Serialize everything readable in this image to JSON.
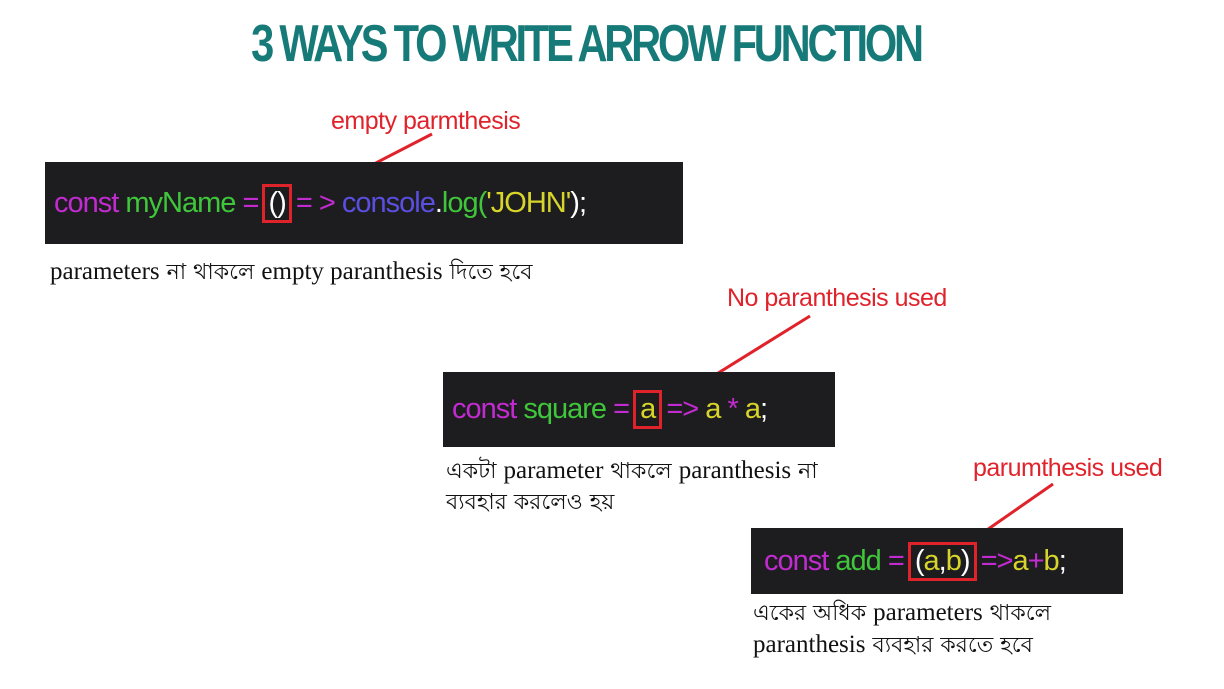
{
  "title": "3 WAYS TO WRITE ARROW FUNCTION",
  "colors": {
    "title": "#157a78",
    "annotation": "#e0232b",
    "code_bg": "#1d1d20",
    "keyword": "#c22bd0",
    "identifier": "#3fc63a",
    "operator": "#c22bd0",
    "console": "#5a4fe0",
    "string": "#d8d52a",
    "param": "#d8d52a",
    "plain": "#ffffff"
  },
  "examples": [
    {
      "annotation": "empty parmthesis",
      "code": {
        "kw": "const",
        "name": "myName",
        "eq": "=",
        "params": "()",
        "arrow": "= >",
        "console": "console",
        "dot": ".",
        "log": "log(",
        "str": "'JOHN'",
        "end": ");"
      },
      "note": [
        {
          "en": "parameters"
        },
        {
          "bn": " না থাকলে "
        },
        {
          "en": "empty paranthesis"
        },
        {
          "bn": " দিতে হবে"
        }
      ]
    },
    {
      "annotation": "No paranthesis used",
      "code": {
        "kw": "const",
        "name": "square",
        "eq": "=",
        "params": "a",
        "arrow": "=>",
        "a1": "a",
        "op": "*",
        "a2": "a",
        "end": ";"
      },
      "note_line1": {
        "bn1": "একটা ",
        "en1": "parameter",
        "bn2": " থাকলে ",
        "en2": "paranthesis",
        "bn3": " না"
      },
      "note_line2": "ব্যবহার করলেও হয়"
    },
    {
      "annotation": "parumthesis used",
      "code": {
        "kw": "const",
        "name": "add",
        "eq": "=",
        "params_open": "(",
        "params_a": "a",
        "params_comma": ",",
        "params_b": "b",
        "params_close": ")",
        "arrow": "=>",
        "a": "a",
        "plus": "+",
        "b": "b",
        "end": ";"
      },
      "note_line1": {
        "bn1": "একের অধিক ",
        "en1": "parameters",
        "bn2": " থাকলে"
      },
      "note_line2": {
        "en1": "paranthesis",
        "bn1": " ব্যবহার করতে হবে"
      }
    }
  ]
}
